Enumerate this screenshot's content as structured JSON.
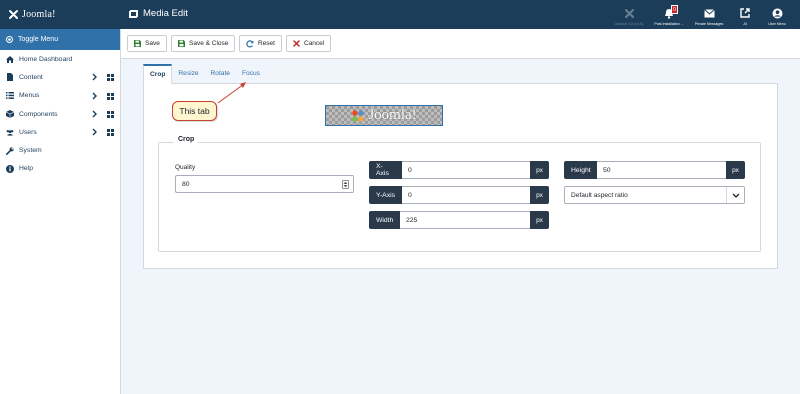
{
  "header": {
    "logo_text": "Joomla!",
    "page_title": "Media Edit",
    "items": [
      {
        "label": "Joomla! 4.0 (v4.0)",
        "icon": "joomla-icon",
        "muted": true
      },
      {
        "label": "Post Installation ...",
        "icon": "bell-icon",
        "badge": "0"
      },
      {
        "label": "Private Messages",
        "icon": "envelope-icon"
      },
      {
        "label": "J4",
        "icon": "external-link-icon"
      },
      {
        "label": "User Menu",
        "icon": "user-circle-icon"
      }
    ]
  },
  "sidebar": {
    "toggle_label": "Toggle Menu",
    "items": [
      {
        "label": "Home Dashboard",
        "icon": "home-icon",
        "submenu": false
      },
      {
        "label": "Content",
        "icon": "file-icon",
        "submenu": true
      },
      {
        "label": "Menus",
        "icon": "list-icon",
        "submenu": true
      },
      {
        "label": "Components",
        "icon": "cube-icon",
        "submenu": true
      },
      {
        "label": "Users",
        "icon": "users-icon",
        "submenu": true
      },
      {
        "label": "System",
        "icon": "wrench-icon",
        "submenu": false
      },
      {
        "label": "Help",
        "icon": "info-icon",
        "submenu": false
      }
    ]
  },
  "toolbar": {
    "save_label": "Save",
    "save_close_label": "Save & Close",
    "reset_label": "Reset",
    "cancel_label": "Cancel"
  },
  "tabs": [
    {
      "label": "Crop",
      "active": true
    },
    {
      "label": "Resize",
      "active": false
    },
    {
      "label": "Rotate",
      "active": false
    },
    {
      "label": "Focus",
      "active": false
    }
  ],
  "callout": {
    "text": "This tab"
  },
  "preview": {
    "logo_text": "Joomla!"
  },
  "crop": {
    "legend": "Crop",
    "quality_label": "Quality",
    "quality_value": "80",
    "x_axis_label": "X-Axis",
    "x_axis_value": "0",
    "y_axis_label": "Y-Axis",
    "y_axis_value": "0",
    "width_label": "Width",
    "width_value": "225",
    "height_label": "Height",
    "height_value": "50",
    "unit": "px",
    "aspect_ratio_value": "Default aspect ratio"
  },
  "colors": {
    "header_bg": "#1c3d5a",
    "accent": "#3071a9",
    "input_group_label_bg": "#2b3a4b",
    "badge_bg": "#c52827",
    "callout_border": "#c7412d"
  }
}
